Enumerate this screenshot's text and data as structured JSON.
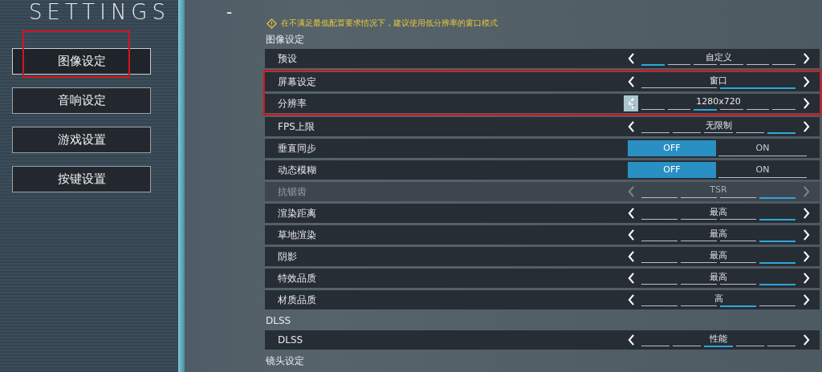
{
  "title": "SETTINGS",
  "title_dash": "-",
  "menu": [
    {
      "label": "图像设定",
      "selected": true,
      "annotated": true
    },
    {
      "label": "音响设定",
      "selected": false,
      "annotated": false
    },
    {
      "label": "游戏设置",
      "selected": false,
      "annotated": false
    },
    {
      "label": "按键设置",
      "selected": false,
      "annotated": false
    }
  ],
  "warning": "在不满足最低配置要求情况下，建议使用低分辨率的窗口模式",
  "sections": [
    {
      "title": "图像设定",
      "rows": [
        {
          "kind": "selector",
          "label": "预设",
          "value": "自定义",
          "disabled": false,
          "annotated": false,
          "left_hovered": false,
          "segments": [
            true,
            false,
            false,
            false,
            false,
            false
          ]
        },
        {
          "kind": "selector",
          "label": "屏幕设定",
          "value": "窗口",
          "disabled": false,
          "annotated": true,
          "left_hovered": false,
          "segments": [
            false,
            true
          ]
        },
        {
          "kind": "selector",
          "label": "分辨率",
          "value": "1280x720",
          "disabled": false,
          "annotated": true,
          "left_hovered": true,
          "segments": [
            false,
            false,
            true,
            false,
            false,
            false
          ]
        },
        {
          "kind": "selector",
          "label": "FPS上限",
          "value": "无限制",
          "disabled": false,
          "annotated": false,
          "left_hovered": false,
          "segments": [
            false,
            false,
            false,
            false,
            true
          ]
        },
        {
          "kind": "toggle",
          "label": "垂直同步",
          "options": [
            {
              "label": "OFF",
              "selected": true
            },
            {
              "label": "ON",
              "selected": false
            }
          ]
        },
        {
          "kind": "toggle",
          "label": "动态模糊",
          "options": [
            {
              "label": "OFF",
              "selected": true
            },
            {
              "label": "ON",
              "selected": false
            }
          ]
        },
        {
          "kind": "selector",
          "label": "抗锯齿",
          "value": "TSR",
          "disabled": true,
          "annotated": false,
          "left_hovered": false,
          "segments": [
            false,
            false,
            false,
            true
          ]
        },
        {
          "kind": "selector",
          "label": "渲染距离",
          "value": "最高",
          "disabled": false,
          "annotated": false,
          "left_hovered": false,
          "segments": [
            false,
            false,
            false,
            true
          ]
        },
        {
          "kind": "selector",
          "label": "草地渲染",
          "value": "最高",
          "disabled": false,
          "annotated": false,
          "left_hovered": false,
          "segments": [
            false,
            false,
            false,
            true
          ]
        },
        {
          "kind": "selector",
          "label": "阴影",
          "value": "最高",
          "disabled": false,
          "annotated": false,
          "left_hovered": false,
          "segments": [
            false,
            false,
            false,
            true
          ]
        },
        {
          "kind": "selector",
          "label": "特效品质",
          "value": "最高",
          "disabled": false,
          "annotated": false,
          "left_hovered": false,
          "segments": [
            false,
            false,
            false,
            true
          ]
        },
        {
          "kind": "selector",
          "label": "材质品质",
          "value": "高",
          "disabled": false,
          "annotated": false,
          "left_hovered": false,
          "segments": [
            false,
            false,
            true,
            false
          ]
        }
      ]
    },
    {
      "title": "DLSS",
      "rows": [
        {
          "kind": "selector",
          "label": "DLSS",
          "value": "性能",
          "disabled": false,
          "annotated": false,
          "left_hovered": false,
          "segments": [
            false,
            false,
            true,
            false,
            false
          ]
        }
      ]
    },
    {
      "title": "镜头设定"
    }
  ]
}
